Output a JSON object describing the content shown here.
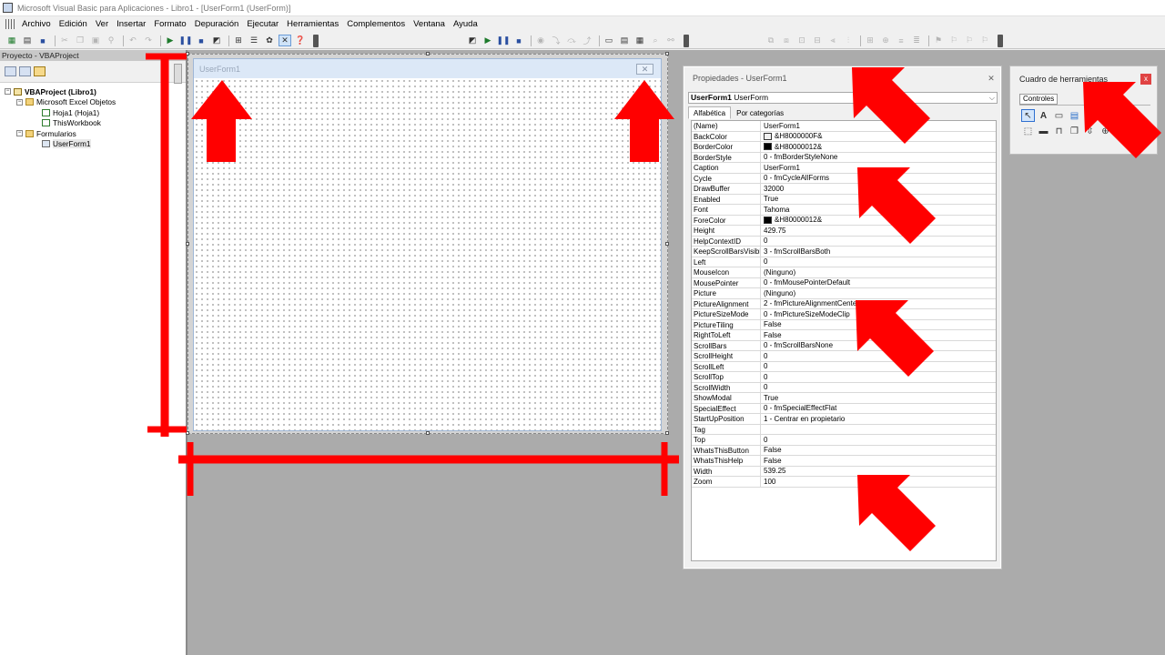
{
  "window": {
    "title": "Microsoft Visual Basic para Aplicaciones - Libro1 - [UserForm1 (UserForm)]"
  },
  "menu": {
    "items": [
      "Archivo",
      "Edición",
      "Ver",
      "Insertar",
      "Formato",
      "Depuración",
      "Ejecutar",
      "Herramientas",
      "Complementos",
      "Ventana",
      "Ayuda"
    ]
  },
  "project": {
    "title": "Proyecto - VBAProject",
    "tree": [
      {
        "label": "VBAProject (Libro1)"
      },
      {
        "label": "Microsoft Excel Objetos"
      },
      {
        "label": "Hoja1 (Hoja1)"
      },
      {
        "label": "ThisWorkbook"
      },
      {
        "label": "Formularios"
      },
      {
        "label": "UserForm1"
      }
    ]
  },
  "userform": {
    "caption": "UserForm1",
    "close_glyph": "✕"
  },
  "properties": {
    "title": "Propiedades - UserForm1",
    "object_name": "UserForm1",
    "object_type": "UserForm",
    "tabs": [
      "Alfabética",
      "Por categorías"
    ],
    "rows": [
      {
        "name": "(Name)",
        "value": "UserForm1"
      },
      {
        "name": "BackColor",
        "value": "&H8000000F&",
        "swatch": "#f0f0f0"
      },
      {
        "name": "BorderColor",
        "value": "&H80000012&",
        "swatch": "#000000"
      },
      {
        "name": "BorderStyle",
        "value": "0 - fmBorderStyleNone"
      },
      {
        "name": "Caption",
        "value": "UserForm1"
      },
      {
        "name": "Cycle",
        "value": "0 - fmCycleAllForms"
      },
      {
        "name": "DrawBuffer",
        "value": "32000"
      },
      {
        "name": "Enabled",
        "value": "True"
      },
      {
        "name": "Font",
        "value": "Tahoma"
      },
      {
        "name": "ForeColor",
        "value": "&H80000012&",
        "swatch": "#000000"
      },
      {
        "name": "Height",
        "value": "429.75"
      },
      {
        "name": "HelpContextID",
        "value": "0"
      },
      {
        "name": "KeepScrollBarsVisible",
        "value": "3 - fmScrollBarsBoth"
      },
      {
        "name": "Left",
        "value": "0"
      },
      {
        "name": "MouseIcon",
        "value": "(Ninguno)"
      },
      {
        "name": "MousePointer",
        "value": "0 - fmMousePointerDefault"
      },
      {
        "name": "Picture",
        "value": "(Ninguno)"
      },
      {
        "name": "PictureAlignment",
        "value": "2 - fmPictureAlignmentCenter"
      },
      {
        "name": "PictureSizeMode",
        "value": "0 - fmPictureSizeModeClip"
      },
      {
        "name": "PictureTiling",
        "value": "False"
      },
      {
        "name": "RightToLeft",
        "value": "False"
      },
      {
        "name": "ScrollBars",
        "value": "0 - fmScrollBarsNone"
      },
      {
        "name": "ScrollHeight",
        "value": "0"
      },
      {
        "name": "ScrollLeft",
        "value": "0"
      },
      {
        "name": "ScrollTop",
        "value": "0"
      },
      {
        "name": "ScrollWidth",
        "value": "0"
      },
      {
        "name": "ShowModal",
        "value": "True"
      },
      {
        "name": "SpecialEffect",
        "value": "0 - fmSpecialEffectFlat"
      },
      {
        "name": "StartUpPosition",
        "value": "1 - Centrar en propietario"
      },
      {
        "name": "Tag",
        "value": ""
      },
      {
        "name": "Top",
        "value": "0"
      },
      {
        "name": "WhatsThisButton",
        "value": "False"
      },
      {
        "name": "WhatsThisHelp",
        "value": "False"
      },
      {
        "name": "Width",
        "value": "539.25"
      },
      {
        "name": "Zoom",
        "value": "100"
      }
    ]
  },
  "toolbox": {
    "title": "Cuadro de herramientas",
    "tab": "Controles",
    "close_glyph": "x"
  },
  "colors": {
    "annotation_red": "#ff0000",
    "form_titlebar": "#dce8f7",
    "mdi_background": "#ababab"
  }
}
